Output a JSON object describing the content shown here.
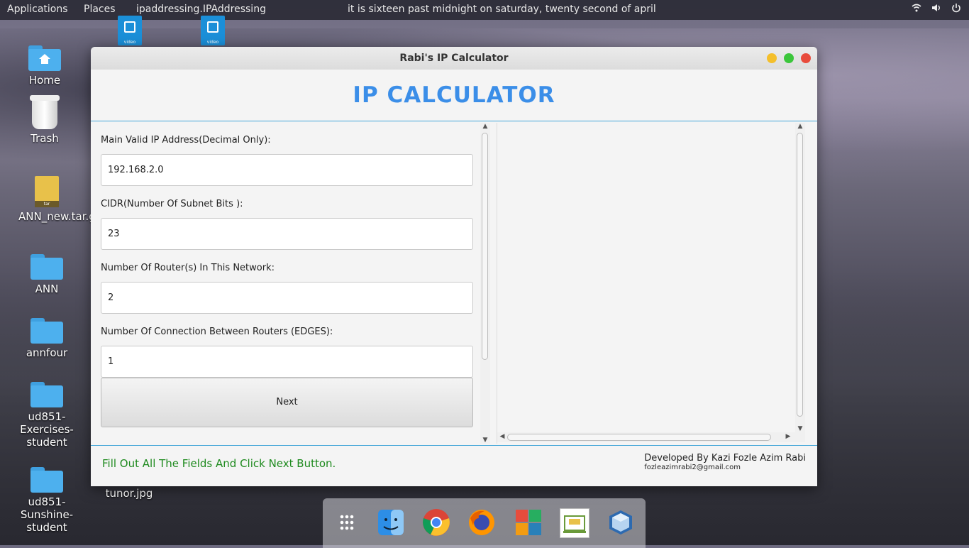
{
  "topbar": {
    "applications": "Applications",
    "places": "Places",
    "active_app": "ipaddressing.IPAddressing",
    "clock": "it is sixteen past midnight on saturday, twenty second of april",
    "tray_icons": [
      "wifi-icon",
      "volume-icon",
      "power-icon"
    ]
  },
  "desktop": {
    "home": "Home",
    "trash": "Trash",
    "tar": "ANN_new.tar.gz",
    "ann": "ANN",
    "annfour": "annfour",
    "ud851_ex": "ud851-Exercises-student",
    "ud851_sun": "ud851-Sunshine-student",
    "tunor": "tunor.jpg",
    "video_label": "video"
  },
  "window": {
    "title": "Rabi's IP Calculator",
    "heading": "IP CALCULATOR",
    "fields": {
      "ip_label": "Main Valid IP Address(Decimal Only):",
      "ip_value": "192.168.2.0",
      "cidr_label": "CIDR(Number Of Subnet Bits ):",
      "cidr_value": "23",
      "routers_label": "Number Of Router(s) In This Network:",
      "routers_value": "2",
      "edges_label": "Number Of Connection Between Routers (EDGES):",
      "edges_value": "1"
    },
    "next_label": "Next",
    "status": "Fill Out All The Fields And Click Next Button.",
    "credit": "Developed By Kazi Fozle Azim Rabi",
    "email": "fozleazimrabi2@gmail.com"
  },
  "colors": {
    "heading": "#3b8ee8",
    "status": "#1e8a1e",
    "close": "#e84b3c",
    "minimize": "#f4bf2b",
    "maximize": "#3bc63b"
  },
  "dock": [
    "apps-grid-icon",
    "finder-icon",
    "chrome-icon",
    "firefox-icon",
    "tiles-icon",
    "rabis-calculator-icon",
    "virtualbox-icon"
  ]
}
